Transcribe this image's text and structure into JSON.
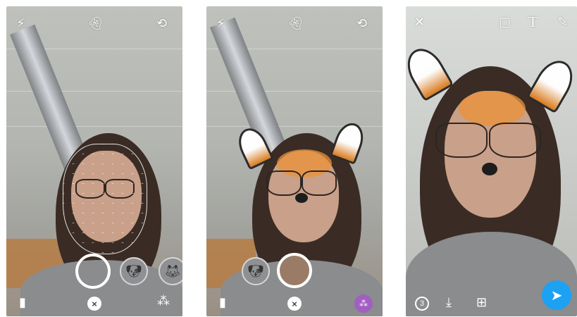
{
  "panels": [
    {
      "name": "camera-mesh",
      "top_icons": [
        "flash-off-icon",
        "snapchat-ghost-icon",
        "flip-camera-icon"
      ],
      "bottom_icons": [
        "chat-icon",
        "close-lens-icon",
        "lens-grid-icon"
      ]
    },
    {
      "name": "camera-fox-lens",
      "top_icons": [
        "flash-off-icon",
        "snapchat-ghost-icon",
        "flip-camera-icon"
      ],
      "bottom_icons": [
        "chat-icon",
        "close-lens-icon",
        "lens-active-icon"
      ]
    },
    {
      "name": "snap-preview",
      "top_icons": [
        "close-icon",
        "sticker-icon",
        "text-icon",
        "pencil-icon"
      ],
      "text_tool_label": "T",
      "timer_value": "3",
      "bottom_icons": [
        "timer-icon",
        "download-icon",
        "add-to-story-icon",
        "send-icon"
      ]
    }
  ],
  "colors": {
    "send_blue": "#1da1f2",
    "lens_purple": "#a15fc1",
    "fox_orange": "#d97a1d"
  }
}
